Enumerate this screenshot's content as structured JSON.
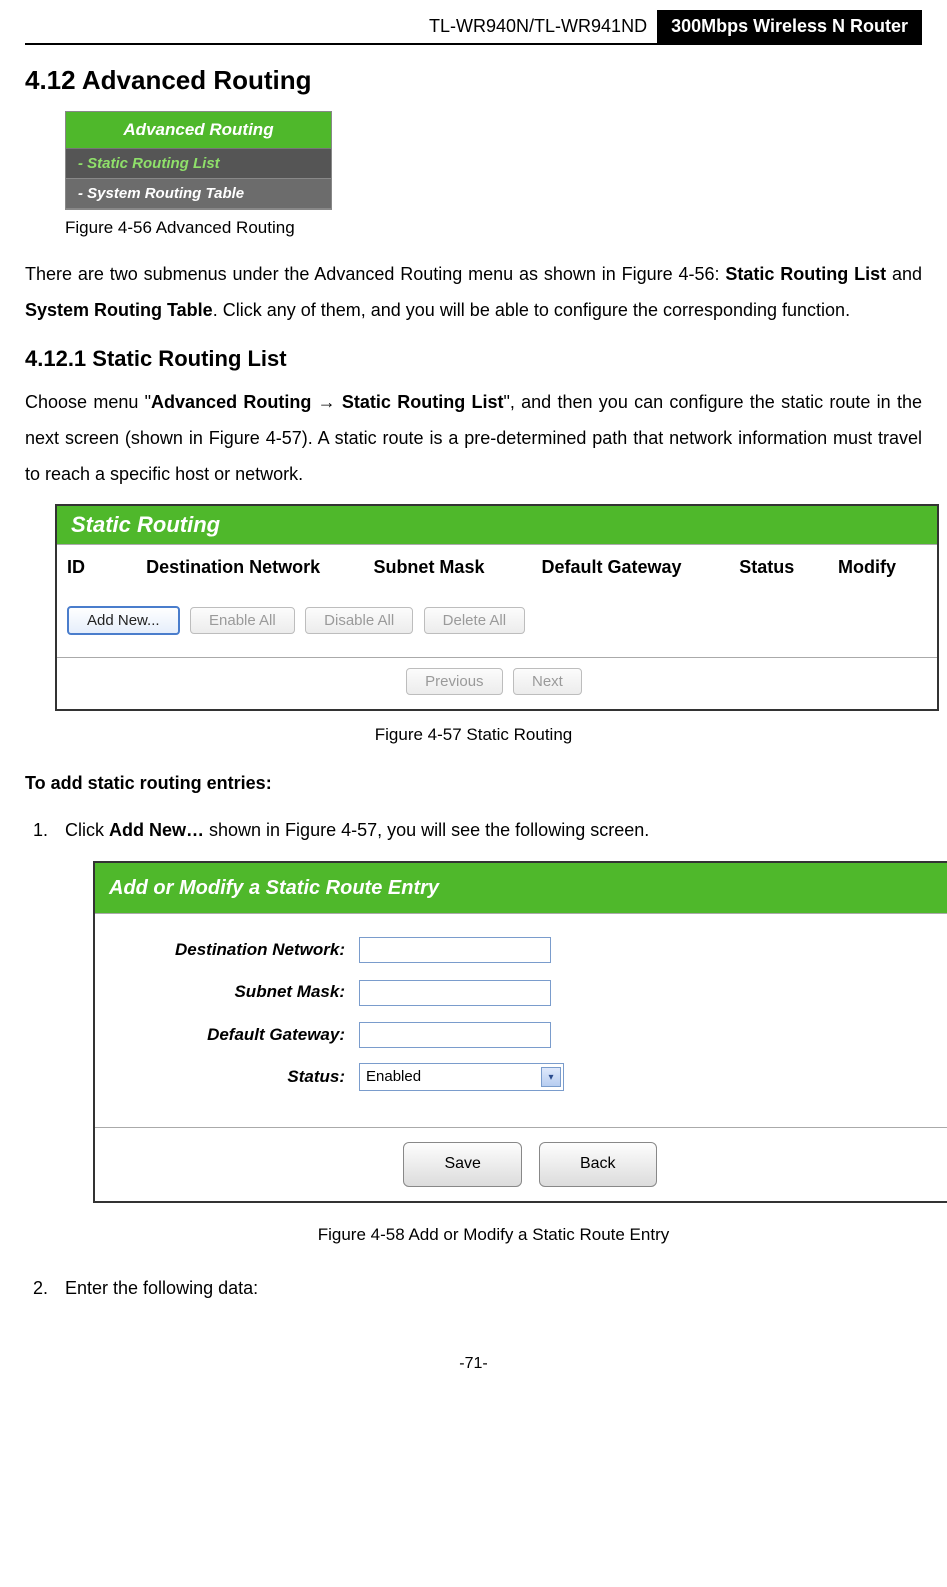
{
  "header": {
    "model": "TL-WR940N/TL-WR941ND",
    "product": "300Mbps Wireless N Router"
  },
  "section": {
    "num_title": "4.12  Advanced Routing",
    "sub_num_title": "4.12.1 Static Routing List"
  },
  "fig56": {
    "menu_header": "Advanced Routing",
    "item1": "- Static Routing List",
    "item2": "- System Routing Table",
    "caption": "Figure 4-56    Advanced Routing"
  },
  "para1": {
    "t1": "There are two submenus under the Advanced Routing menu as shown in Figure 4-56: ",
    "b1": "Static Routing List",
    "t2": " and ",
    "b2": "System Routing Table",
    "t3": ". Click any of them, and you will be able to configure the corresponding function."
  },
  "para2": {
    "t1": "Choose menu \"",
    "b1": "Advanced Routing → Static Routing List",
    "t2": "\", and then you can configure the static route in the next screen (shown in Figure 4-57). A static route is a pre-determined path that network information must travel to reach a specific host or network."
  },
  "fig57": {
    "panel_title": "Static Routing",
    "cols": {
      "c1": "ID",
      "c2": "Destination Network",
      "c3": "Subnet Mask",
      "c4": "Default Gateway",
      "c5": "Status",
      "c6": "Modify"
    },
    "btns": {
      "add": "Add New...",
      "enable": "Enable All",
      "disable": "Disable All",
      "delete": "Delete All",
      "prev": "Previous",
      "next": "Next"
    },
    "caption": "Figure 4-57    Static Routing"
  },
  "add_heading": "To add static routing entries:",
  "steps": {
    "s1a": "Click ",
    "s1b": "Add New…",
    "s1c": " shown in Figure 4-57, you will see the following screen.",
    "s2": "Enter the following data:"
  },
  "fig58": {
    "panel_title": "Add or Modify a Static Route Entry",
    "labels": {
      "dest": "Destination Network:",
      "mask": "Subnet Mask:",
      "gw": "Default Gateway:",
      "status": "Status:"
    },
    "select_value": "Enabled",
    "btns": {
      "save": "Save",
      "back": "Back"
    },
    "caption": "Figure 4-58    Add or Modify a Static Route Entry"
  },
  "page_num": "-71-"
}
